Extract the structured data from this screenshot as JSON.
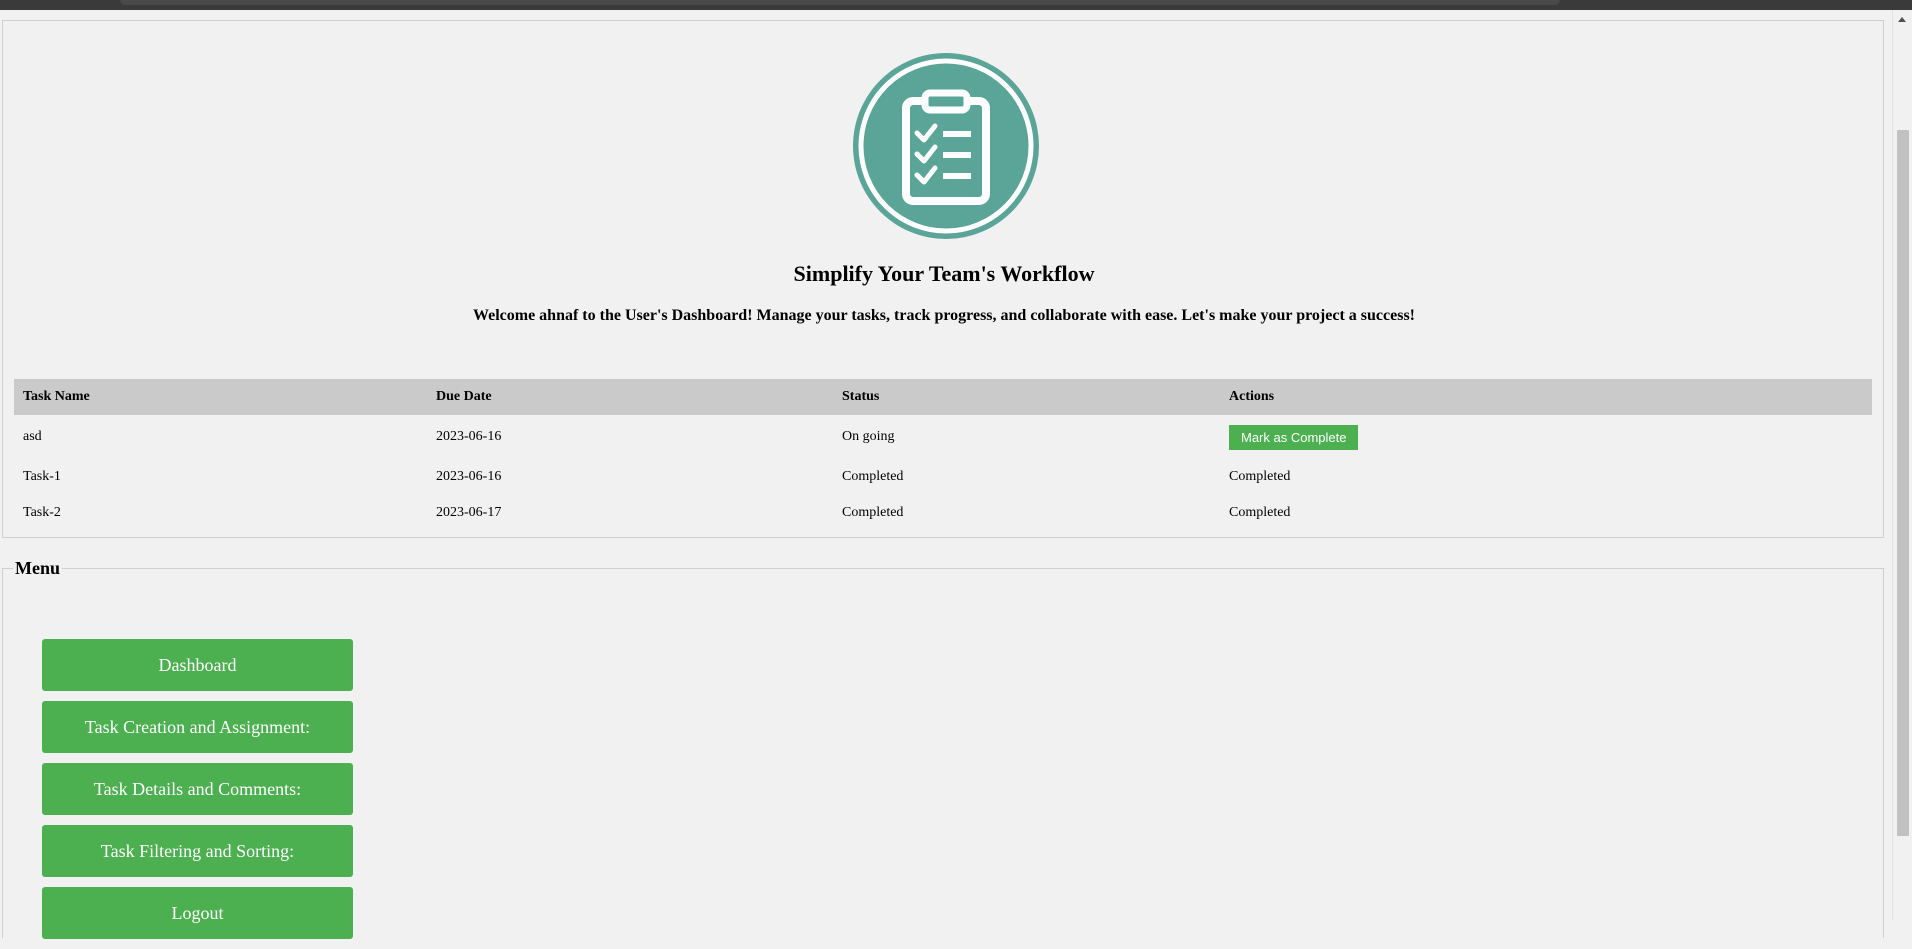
{
  "header": {
    "logo_icon": "clipboard-checklist-icon",
    "logo_color": "#5aa598",
    "headline": "Simplify Your Team's Workflow",
    "welcome": "Welcome ahnaf to the User's Dashboard! Manage your tasks, track progress, and collaborate with ease. Let's make your project a success!"
  },
  "table": {
    "columns": [
      "Task Name",
      "Due Date",
      "Status",
      "Actions"
    ],
    "rows": [
      {
        "name": "asd",
        "due": "2023-06-16",
        "status": "On going",
        "action_button": "Mark as Complete"
      },
      {
        "name": "Task-1",
        "due": "2023-06-16",
        "status": "Completed",
        "action_text": "Completed"
      },
      {
        "name": "Task-2",
        "due": "2023-06-17",
        "status": "Completed",
        "action_text": "Completed"
      }
    ]
  },
  "menu": {
    "legend": "Menu",
    "items": [
      "Dashboard",
      "Task Creation and Assignment:",
      "Task Details and Comments:",
      "Task Filtering and Sorting:",
      "Logout"
    ]
  },
  "colors": {
    "accent": "#4caf50",
    "table_header_bg": "#cacaca"
  }
}
